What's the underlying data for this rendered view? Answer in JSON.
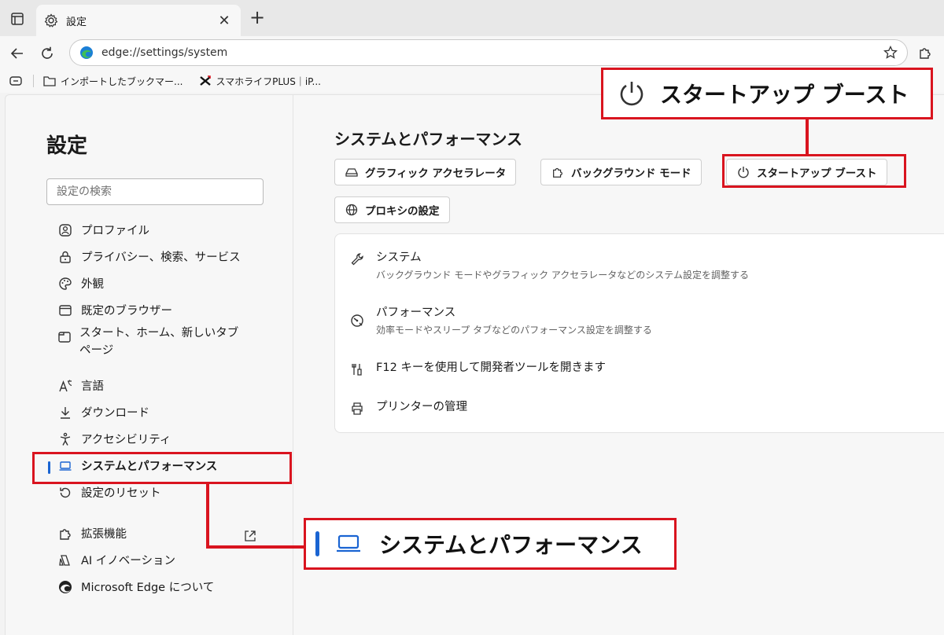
{
  "browser": {
    "tab_title": "設定",
    "tab_close": "✕",
    "new_tab": "+",
    "url": "edge://settings/system",
    "bookmarks": [
      {
        "label": "インポートしたブックマー..."
      },
      {
        "label": "スマホライフPLUS｜iP..."
      }
    ]
  },
  "sidebar": {
    "title": "設定",
    "search_placeholder": "設定の検索",
    "items": [
      {
        "label": "プロファイル",
        "icon": "profile-icon"
      },
      {
        "label": "プライバシー、検索、サービス",
        "icon": "lock-icon"
      },
      {
        "label": "外観",
        "icon": "palette-icon"
      },
      {
        "label": "既定のブラウザー",
        "icon": "browser-icon"
      },
      {
        "label": "スタート、ホーム、新しいタブ ページ",
        "icon": "home-tab-icon"
      },
      {
        "label": "言語",
        "icon": "language-icon"
      },
      {
        "label": "ダウンロード",
        "icon": "download-icon"
      },
      {
        "label": "アクセシビリティ",
        "icon": "accessibility-icon"
      },
      {
        "label": "システムとパフォーマンス",
        "icon": "laptop-icon",
        "active": true
      },
      {
        "label": "設定のリセット",
        "icon": "reset-icon"
      },
      {
        "label": "拡張機能",
        "icon": "puzzle-icon"
      },
      {
        "label": "AI イノベーション",
        "icon": "ai-icon"
      },
      {
        "label": "Microsoft Edge について",
        "icon": "edge-logo-icon"
      }
    ]
  },
  "main": {
    "title": "システムとパフォーマンス",
    "chips": [
      {
        "label": "グラフィック アクセラレータ",
        "icon": "drive-icon"
      },
      {
        "label": "バックグラウンド モード",
        "icon": "puzzle-icon"
      },
      {
        "label": "スタートアップ ブースト",
        "icon": "power-icon"
      },
      {
        "label": "プロキシの設定",
        "icon": "globe-icon"
      }
    ],
    "rows": [
      {
        "title": "システム",
        "desc": "バックグラウンド モードやグラフィック アクセラレータなどのシステム設定を調整する",
        "icon": "wrench-icon"
      },
      {
        "title": "パフォーマンス",
        "desc": "効率モードやスリープ タブなどのパフォーマンス設定を調整する",
        "icon": "gauge-icon"
      },
      {
        "title": "F12 キーを使用して開発者ツールを開きます",
        "icon": "devtools-icon"
      },
      {
        "title": "プリンターの管理",
        "icon": "printer-icon"
      }
    ]
  },
  "annotations": {
    "startup_callout": "スタートアップ ブースト",
    "system_callout": "システムとパフォーマンス",
    "color": "#d9141f"
  },
  "colors": {
    "accent": "#1a64d2",
    "edge_blue": "#1b7fd6",
    "edge_green": "#3fbf56"
  }
}
